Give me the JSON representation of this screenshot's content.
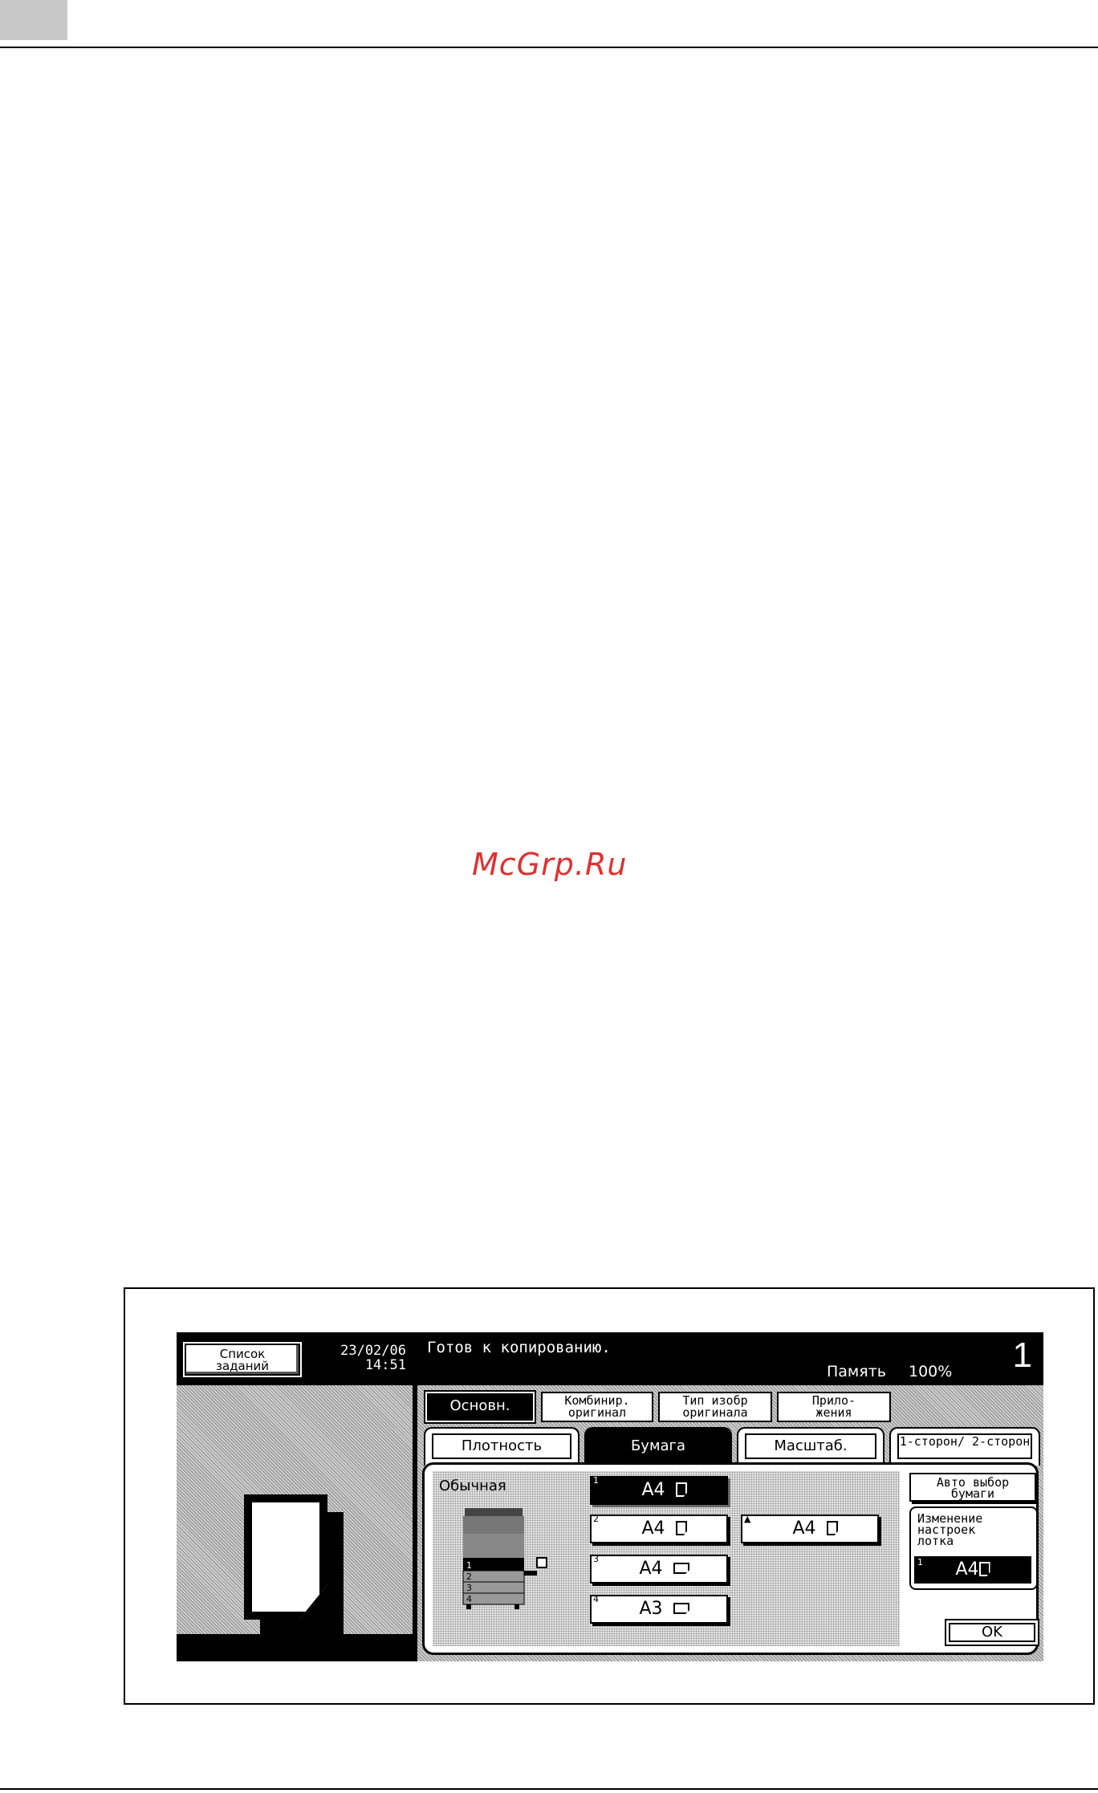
{
  "watermark": "McGrp.Ru",
  "screen": {
    "job_list": "Список заданий",
    "date": "23/02/06",
    "time": "14:51",
    "status": "Готов к копированию.",
    "memory_label": "Память",
    "memory_value": "100%",
    "copies": "1",
    "main_tabs": [
      "Основн.",
      "Комбинир. оригинал",
      "Тип изобр оригинала",
      "Прило-жения"
    ],
    "sub_tabs": [
      "Плотность",
      "Бумага",
      "Масштаб.",
      "1-сторон/ 2-сторон"
    ],
    "paper_type": "Обычная",
    "trays": [
      {
        "num": "1",
        "size": "A4",
        "orient": "portrait",
        "selected": true
      },
      {
        "num": "2",
        "size": "A4",
        "orient": "portrait",
        "selected": false
      },
      {
        "num": "3",
        "size": "A4",
        "orient": "landscape",
        "selected": false
      },
      {
        "num": "4",
        "size": "A3",
        "orient": "landscape",
        "selected": false
      }
    ],
    "bypass": {
      "size": "A4",
      "orient": "portrait"
    },
    "auto_paper": "Авто выбор бумаги",
    "tray_change": "Изменение настроек лотка",
    "tray_change_current": {
      "num": "1",
      "size": "A4"
    },
    "ok": "OK"
  }
}
